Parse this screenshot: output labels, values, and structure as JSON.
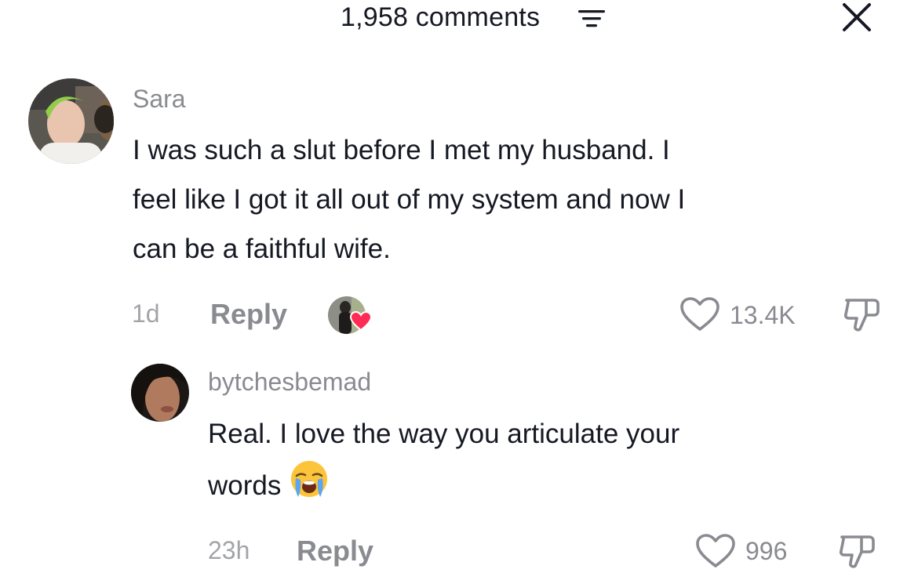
{
  "header": {
    "comment_count_label": "1,958 comments"
  },
  "comments": [
    {
      "username": "Sara",
      "text": "I was such a slut before I met my husband. I feel like I got it all out of my system and now I can be a faithful wife.",
      "lines": [
        "I was such a slut before I met my husband. I",
        "feel like I got it all out of my system and now I",
        "can be a faithful wife."
      ],
      "age": "1d",
      "reply_label": "Reply",
      "likes": "13.4K"
    },
    {
      "username": "bytchesbemad",
      "lines": [
        "Real. I love the way you articulate your",
        "words"
      ],
      "emoji": "loudly-crying-face",
      "age": "23h",
      "reply_label": "Reply",
      "likes": "996"
    }
  ],
  "colors": {
    "text_primary": "#161823",
    "text_secondary": "#8a8b91",
    "heart_badge": "#fe2c55"
  }
}
